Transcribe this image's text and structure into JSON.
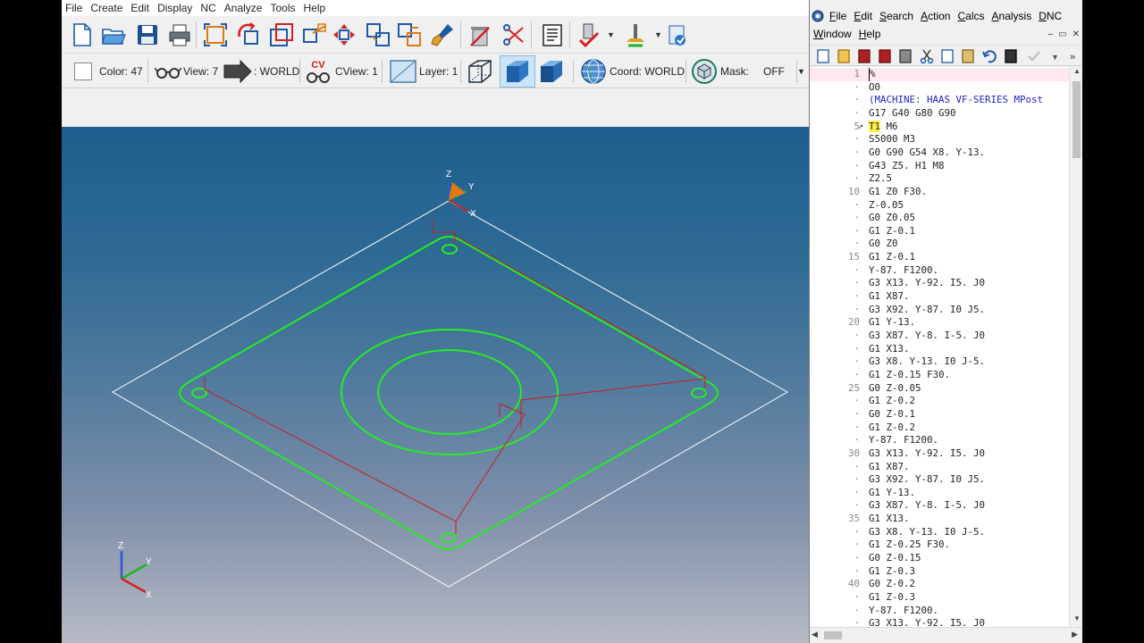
{
  "cad": {
    "menu": [
      "File",
      "Create",
      "Edit",
      "Display",
      "NC",
      "Analyze",
      "Tools",
      "Help"
    ],
    "toolbar1_icons": [
      "new-file-icon",
      "open-folder-icon",
      "save-icon",
      "print-icon",
      "zoom-fit-icon",
      "rotate-view-icon",
      "zoom-window-icon",
      "zoom-box-icon",
      "pan-icon",
      "select-group-icon",
      "deselect-group-icon",
      "paint-brush-icon",
      "trash-delete-icon",
      "scissors-trim-icon",
      "nc-list-icon",
      "toolpath-verify-icon",
      "tool-library-icon",
      "post-process-icon"
    ],
    "toolbar2": {
      "color_label": "Color: 47",
      "view_label": "View: 7",
      "coord_system_label": ": WORLD",
      "cv_badge": "CV",
      "cview_label": "CView: 1",
      "layer_label": "Layer: 1",
      "coord_label": "Coord: WORLD",
      "mask_label": "Mask:",
      "mask_value": "OFF"
    },
    "axis_labels": {
      "x": "X",
      "y": "Y",
      "z": "Z"
    }
  },
  "editor": {
    "menu_row1": [
      {
        "label": "File",
        "u": "F"
      },
      {
        "label": "Edit",
        "u": "E"
      },
      {
        "label": "Search",
        "u": "S"
      },
      {
        "label": "Action",
        "u": "A"
      },
      {
        "label": "Calcs",
        "u": "C"
      },
      {
        "label": "Analysis",
        "u": "A"
      },
      {
        "label": "DNC",
        "u": "D"
      }
    ],
    "menu_row2": [
      {
        "label": "Window",
        "u": "W"
      },
      {
        "label": "Help",
        "u": "H"
      }
    ],
    "window_controls": [
      "–",
      "▭",
      "✕"
    ],
    "lines": [
      {
        "num": "1",
        "code": "%",
        "type": "cursor"
      },
      {
        "num": "·",
        "code": "O0",
        "type": "normal"
      },
      {
        "num": "·",
        "code": "(MACHINE: HAAS VF-SERIES MPost",
        "type": "comment"
      },
      {
        "num": "·",
        "code": "G17 G40 G80 G90",
        "type": "normal"
      },
      {
        "num": "5",
        "code": "T1 M6",
        "type": "highlight"
      },
      {
        "num": "·",
        "code": "S5000 M3",
        "type": "normal"
      },
      {
        "num": "·",
        "code": "G0 G90 G54 X8. Y-13.",
        "type": "normal"
      },
      {
        "num": "·",
        "code": "G43 Z5. H1 M8",
        "type": "normal"
      },
      {
        "num": "·",
        "code": "Z2.5",
        "type": "normal"
      },
      {
        "num": "10",
        "code": "G1 Z0 F30.",
        "type": "normal"
      },
      {
        "num": "·",
        "code": "Z-0.05",
        "type": "normal"
      },
      {
        "num": "·",
        "code": "G0 Z0.05",
        "type": "normal"
      },
      {
        "num": "·",
        "code": "G1 Z-0.1",
        "type": "normal"
      },
      {
        "num": "·",
        "code": "G0 Z0",
        "type": "normal"
      },
      {
        "num": "15",
        "code": "G1 Z-0.1",
        "type": "normal"
      },
      {
        "num": "·",
        "code": "Y-87. F1200.",
        "type": "normal"
      },
      {
        "num": "·",
        "code": "G3 X13. Y-92. I5. J0",
        "type": "normal"
      },
      {
        "num": "·",
        "code": "G1 X87.",
        "type": "normal"
      },
      {
        "num": "·",
        "code": "G3 X92. Y-87. I0 J5.",
        "type": "normal"
      },
      {
        "num": "20",
        "code": "G1 Y-13.",
        "type": "normal"
      },
      {
        "num": "·",
        "code": "G3 X87. Y-8. I-5. J0",
        "type": "normal"
      },
      {
        "num": "·",
        "code": "G1 X13.",
        "type": "normal"
      },
      {
        "num": "·",
        "code": "G3 X8. Y-13. I0 J-5.",
        "type": "normal"
      },
      {
        "num": "·",
        "code": "G1 Z-0.15 F30.",
        "type": "normal"
      },
      {
        "num": "25",
        "code": "G0 Z-0.05",
        "type": "normal"
      },
      {
        "num": "·",
        "code": "G1 Z-0.2",
        "type": "normal"
      },
      {
        "num": "·",
        "code": "G0 Z-0.1",
        "type": "normal"
      },
      {
        "num": "·",
        "code": "G1 Z-0.2",
        "type": "normal"
      },
      {
        "num": "·",
        "code": "Y-87. F1200.",
        "type": "normal"
      },
      {
        "num": "30",
        "code": "G3 X13. Y-92. I5. J0",
        "type": "normal"
      },
      {
        "num": "·",
        "code": "G1 X87.",
        "type": "normal"
      },
      {
        "num": "·",
        "code": "G3 X92. Y-87. I0 J5.",
        "type": "normal"
      },
      {
        "num": "·",
        "code": "G1 Y-13.",
        "type": "normal"
      },
      {
        "num": "·",
        "code": "G3 X87. Y-8. I-5. J0",
        "type": "normal"
      },
      {
        "num": "35",
        "code": "G1 X13.",
        "type": "normal"
      },
      {
        "num": "·",
        "code": "G3 X8. Y-13. I0 J-5.",
        "type": "normal"
      },
      {
        "num": "·",
        "code": "G1 Z-0.25 F30.",
        "type": "normal"
      },
      {
        "num": "·",
        "code": "G0 Z-0.15",
        "type": "normal"
      },
      {
        "num": "·",
        "code": "G1 Z-0.3",
        "type": "normal"
      },
      {
        "num": "40",
        "code": "G0 Z-0.2",
        "type": "normal"
      },
      {
        "num": "·",
        "code": "G1 Z-0.3",
        "type": "normal"
      },
      {
        "num": "·",
        "code": "Y-87. F1200.",
        "type": "normal"
      },
      {
        "num": "·",
        "code": "G3 X13. Y-92. I5. J0",
        "type": "normal"
      }
    ]
  },
  "colors": {
    "toolpath_green": "#22ee22",
    "rapid_red": "#c81e1e",
    "stock_outline": "#ffffff",
    "highlight_yellow": "#fff14a",
    "comment_blue": "#2020c8"
  }
}
